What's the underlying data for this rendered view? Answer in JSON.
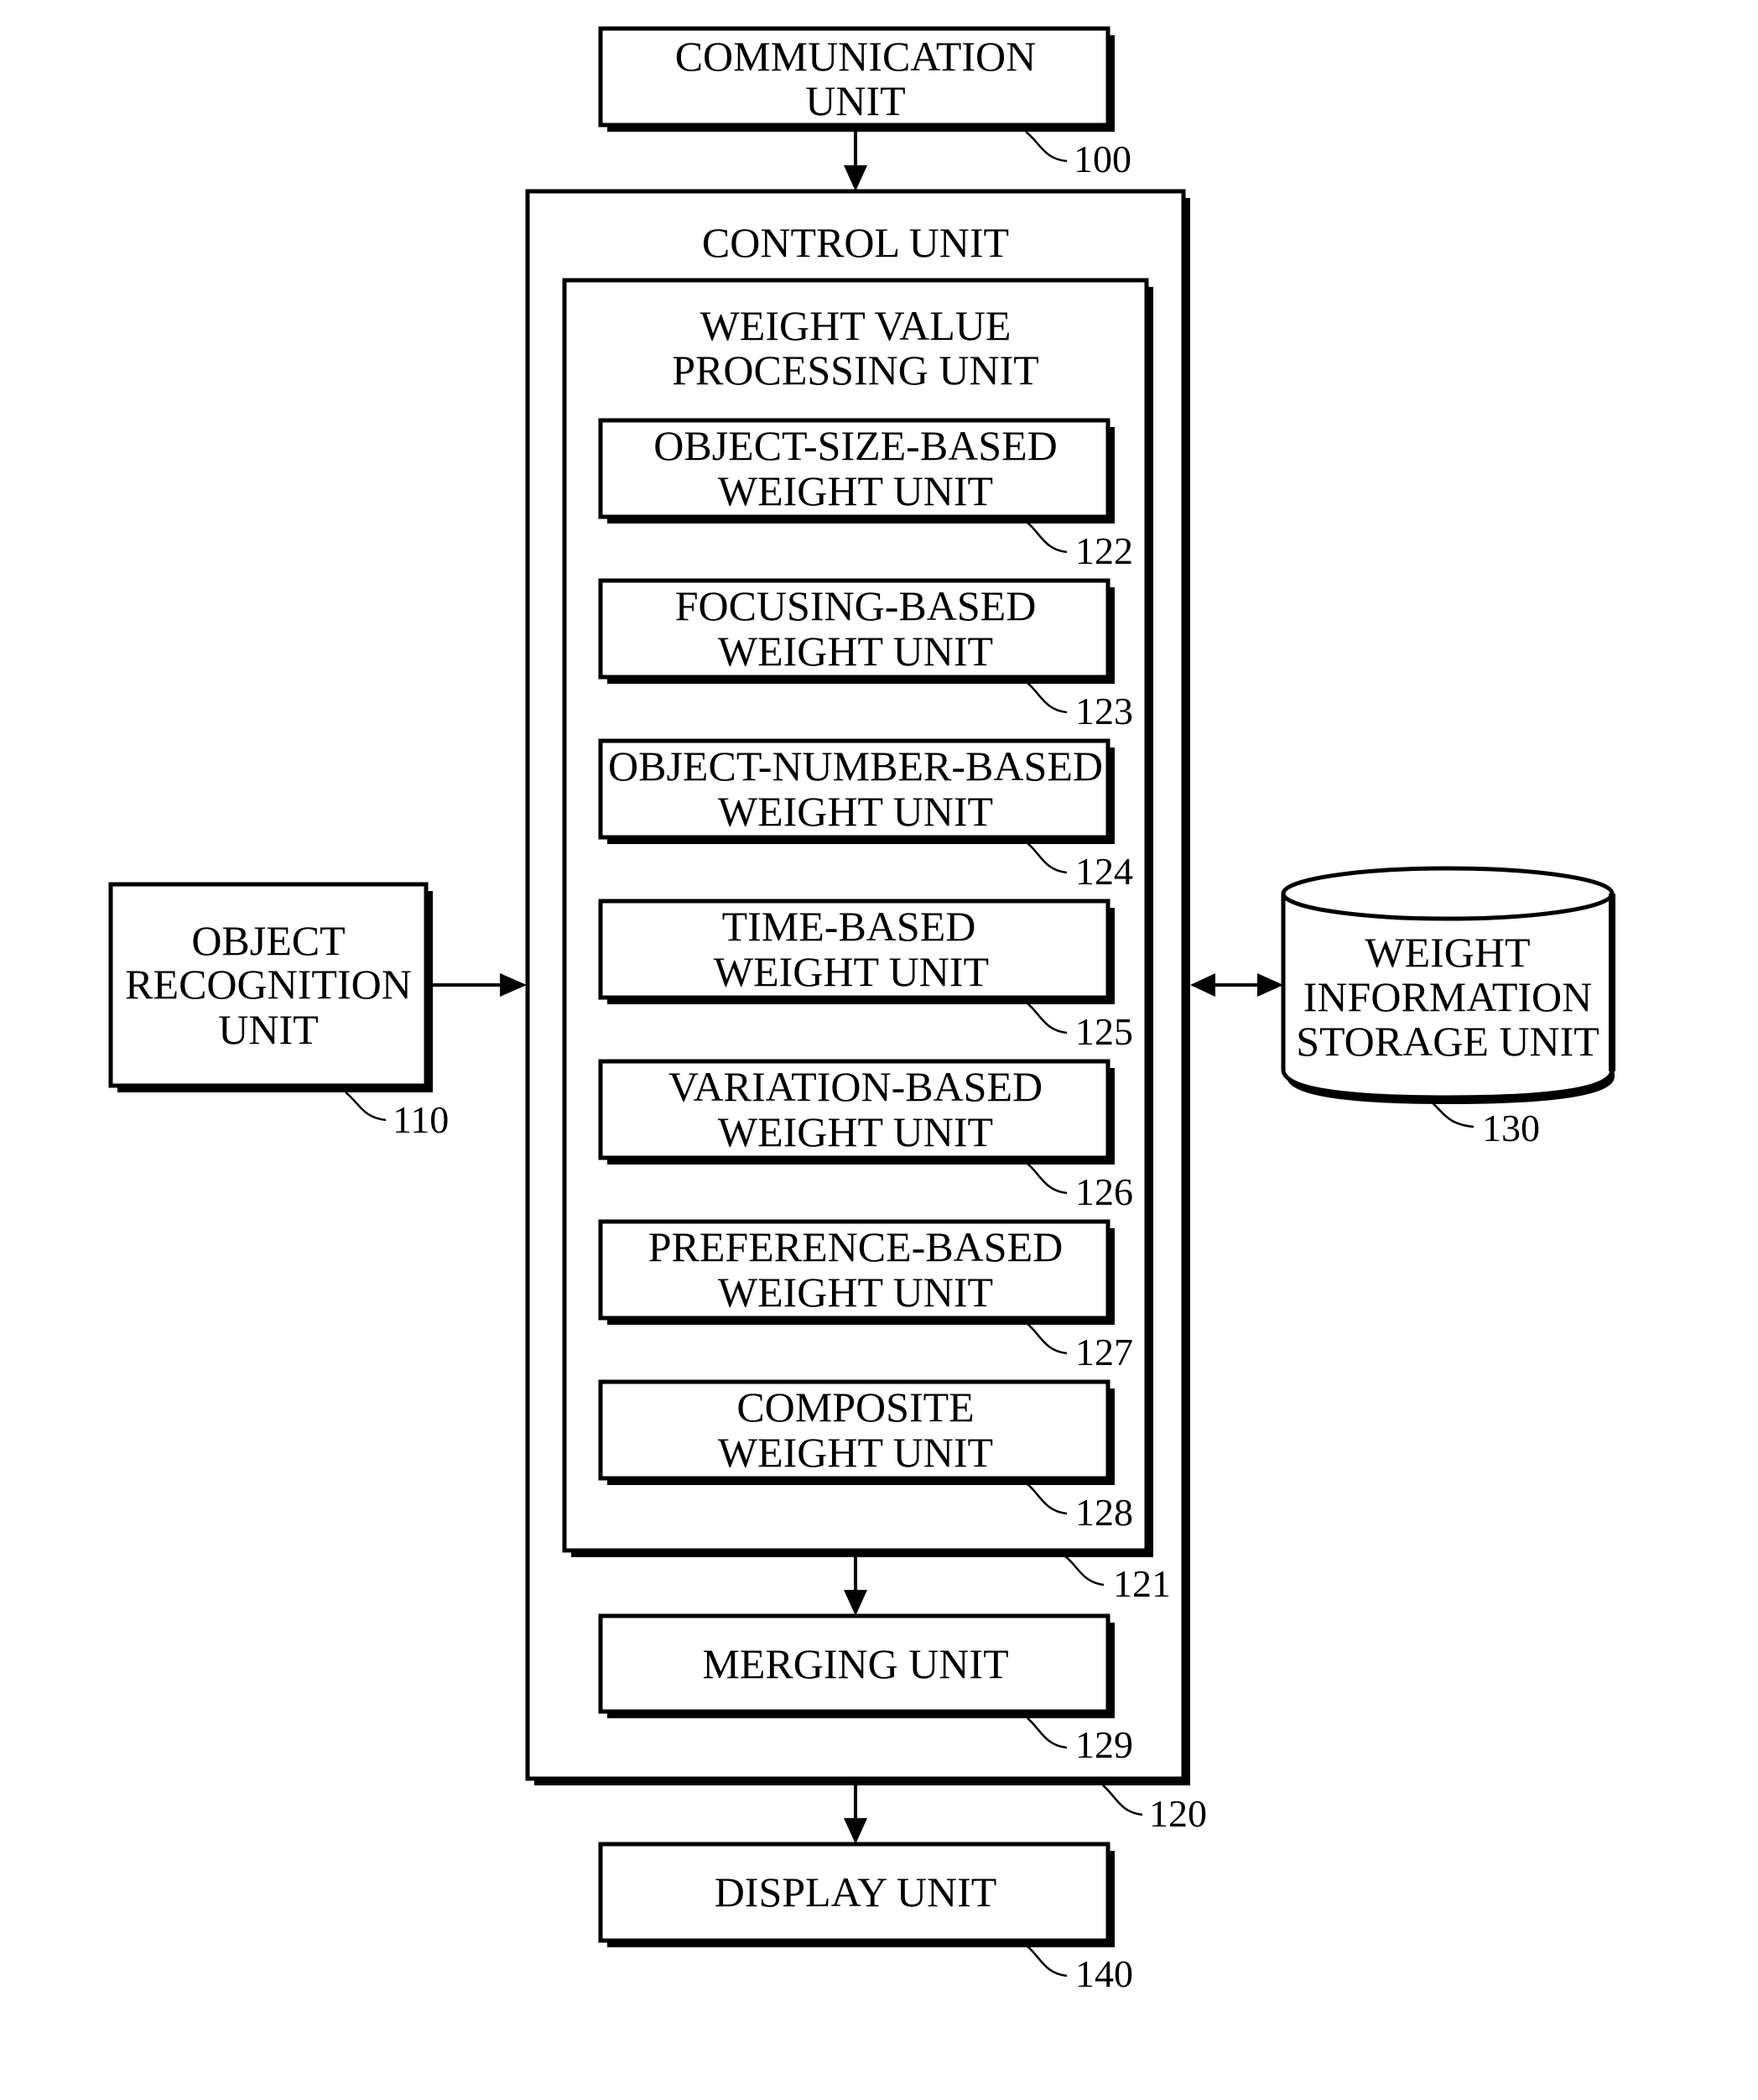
{
  "figure": {
    "communication_unit": {
      "lines": [
        "COMMUNICATION",
        "UNIT"
      ],
      "ref": "100"
    },
    "object_recognition_unit": {
      "lines": [
        "OBJECT",
        "RECOGNITION",
        "UNIT"
      ],
      "ref": "110"
    },
    "control_unit": {
      "title": "CONTROL UNIT",
      "ref": "120"
    },
    "weight_value_processing_unit": {
      "lines": [
        "WEIGHT VALUE",
        "PROCESSING UNIT"
      ],
      "ref": "121",
      "sub_units": [
        {
          "lines": [
            "OBJECT-SIZE-BASED",
            "WEIGHT UNIT"
          ],
          "ref": "122"
        },
        {
          "lines": [
            "FOCUSING-BASED",
            "WEIGHT UNIT"
          ],
          "ref": "123"
        },
        {
          "lines": [
            "OBJECT-NUMBER-BASED",
            "WEIGHT UNIT"
          ],
          "ref": "124"
        },
        {
          "lines": [
            "TIME-BASED",
            "WEIGHT UNIT"
          ],
          "ref": "125"
        },
        {
          "lines": [
            "VARIATION-BASED",
            "WEIGHT UNIT"
          ],
          "ref": "126"
        },
        {
          "lines": [
            "PREFERENCE-BASED",
            "WEIGHT UNIT"
          ],
          "ref": "127"
        },
        {
          "lines": [
            "COMPOSITE",
            "WEIGHT UNIT"
          ],
          "ref": "128"
        }
      ]
    },
    "merging_unit": {
      "lines": [
        "MERGING UNIT"
      ],
      "ref": "129"
    },
    "weight_information_storage_unit": {
      "lines": [
        "WEIGHT",
        "INFORMATION",
        "STORAGE UNIT"
      ],
      "ref": "130"
    },
    "display_unit": {
      "lines": [
        "DISPLAY UNIT"
      ],
      "ref": "140"
    },
    "connections": [
      {
        "from": "COMMUNICATION UNIT",
        "to": "CONTROL UNIT",
        "direction": "one-way"
      },
      {
        "from": "OBJECT RECOGNITION UNIT",
        "to": "CONTROL UNIT",
        "direction": "one-way"
      },
      {
        "from": "CONTROL UNIT",
        "to": "WEIGHT INFORMATION STORAGE UNIT",
        "direction": "two-way"
      },
      {
        "from": "WEIGHT VALUE PROCESSING UNIT",
        "to": "MERGING UNIT",
        "direction": "one-way"
      },
      {
        "from": "CONTROL UNIT",
        "to": "DISPLAY UNIT",
        "direction": "one-way"
      }
    ]
  }
}
